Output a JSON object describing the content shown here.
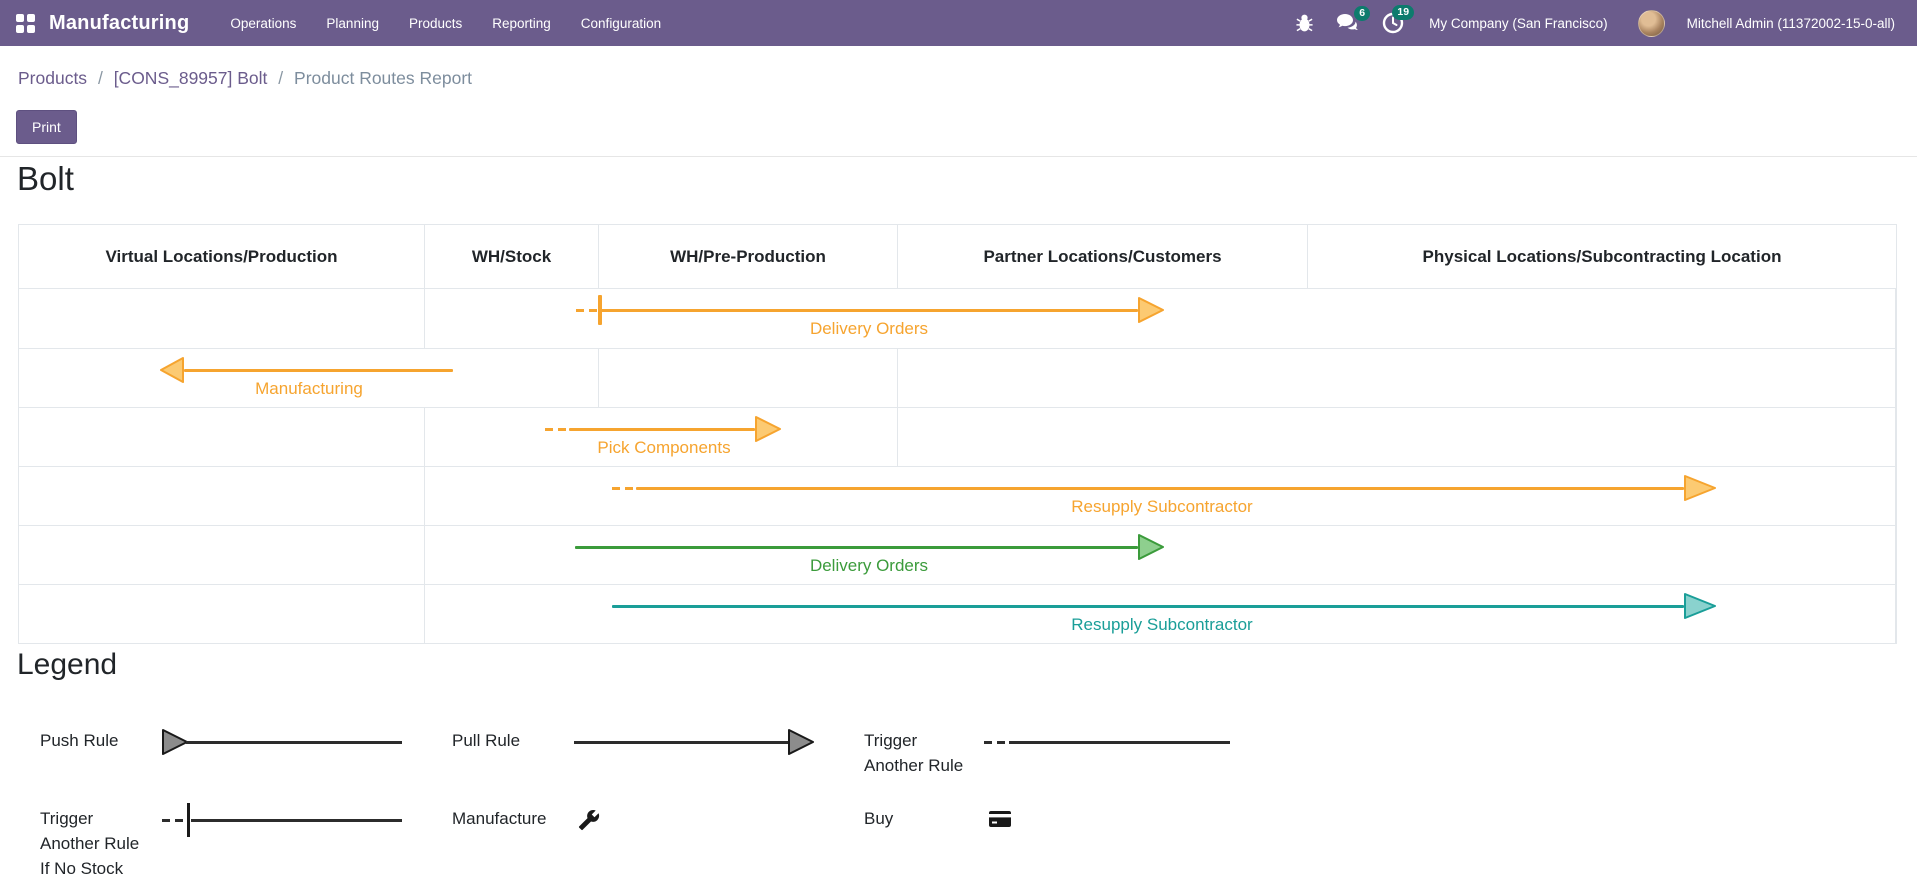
{
  "navbar": {
    "brand": "Manufacturing",
    "menus": [
      "Operations",
      "Planning",
      "Products",
      "Reporting",
      "Configuration"
    ],
    "messages_badge": "6",
    "activities_badge": "19",
    "company": "My Company (San Francisco)",
    "user": "Mitchell Admin (11372002-15-0-all)"
  },
  "breadcrumb": {
    "items": [
      "Products",
      "[CONS_89957] Bolt"
    ],
    "separator": "/",
    "current": "Product Routes Report"
  },
  "actions": {
    "print_label": "Print"
  },
  "report": {
    "title": "Bolt",
    "columns": [
      "Virtual Locations/Production",
      "WH/Stock",
      "WH/Pre-Production",
      "Partner Locations/Customers",
      "Physical Locations/Subcontracting Location"
    ],
    "routes": [
      {
        "label": "Delivery Orders",
        "from": "WH/Stock",
        "to": "Partner Locations/Customers",
        "color": "orange",
        "line_style": "dash_tick_then_solid",
        "direction": "right"
      },
      {
        "label": "Manufacturing",
        "from": "WH/Stock",
        "to": "Virtual Locations/Production",
        "color": "orange",
        "line_style": "solid",
        "direction": "left"
      },
      {
        "label": "Pick Components",
        "from": "WH/Stock",
        "to": "WH/Pre-Production",
        "color": "orange",
        "line_style": "dash_then_solid",
        "direction": "right"
      },
      {
        "label": "Resupply Subcontractor",
        "from": "WH/Stock",
        "to": "Physical Locations/Subcontracting Location",
        "color": "orange",
        "line_style": "dash_then_solid",
        "direction": "right"
      },
      {
        "label": "Delivery Orders",
        "from": "WH/Stock",
        "to": "Partner Locations/Customers",
        "color": "green",
        "line_style": "solid",
        "direction": "right"
      },
      {
        "label": "Resupply Subcontractor",
        "from": "WH/Stock",
        "to": "Physical Locations/Subcontracting Location",
        "color": "teal",
        "line_style": "solid",
        "direction": "right"
      }
    ]
  },
  "legend": {
    "title": "Legend",
    "items": [
      {
        "name": "push-rule",
        "label_lines": [
          "Push Rule"
        ],
        "glyph": "arrow-head-at-start"
      },
      {
        "name": "pull-rule",
        "label_lines": [
          "Pull Rule"
        ],
        "glyph": "arrow-head-at-end"
      },
      {
        "name": "trigger-another-rule",
        "label_lines": [
          "Trigger",
          "Another Rule"
        ],
        "glyph": "dashed-then-solid-line"
      },
      {
        "name": "trigger-another-rule-if-no-stock",
        "label_lines": [
          "Trigger",
          "Another Rule",
          "If No Stock"
        ],
        "glyph": "dash-tick-then-solid-line"
      },
      {
        "name": "manufacture",
        "label_lines": [
          "Manufacture"
        ],
        "glyph": "wrench-icon"
      },
      {
        "name": "buy",
        "label_lines": [
          "Buy"
        ],
        "glyph": "credit-card-icon"
      }
    ]
  },
  "icons": {
    "apps": "apps-grid-icon",
    "debug": "bug-icon",
    "messages": "chat-bubbles-icon",
    "activities": "clock-icon",
    "manufacture": "wrench-icon",
    "buy": "credit-card-icon"
  },
  "colors": {
    "navbar_purple": "#6b5c8c",
    "badge_teal": "#0d7b6d",
    "orange": "#f6a42f",
    "orange_head_fill": "#fcca72",
    "green": "#3b9b3b",
    "green_head_fill": "#8ecf8e",
    "teal": "#1a9e98",
    "teal_head_fill": "#8ad2ce",
    "legend_line": "#2c2c2c",
    "legend_head_fill": "#8c8c8c",
    "table_border": "#e3e7eb"
  }
}
